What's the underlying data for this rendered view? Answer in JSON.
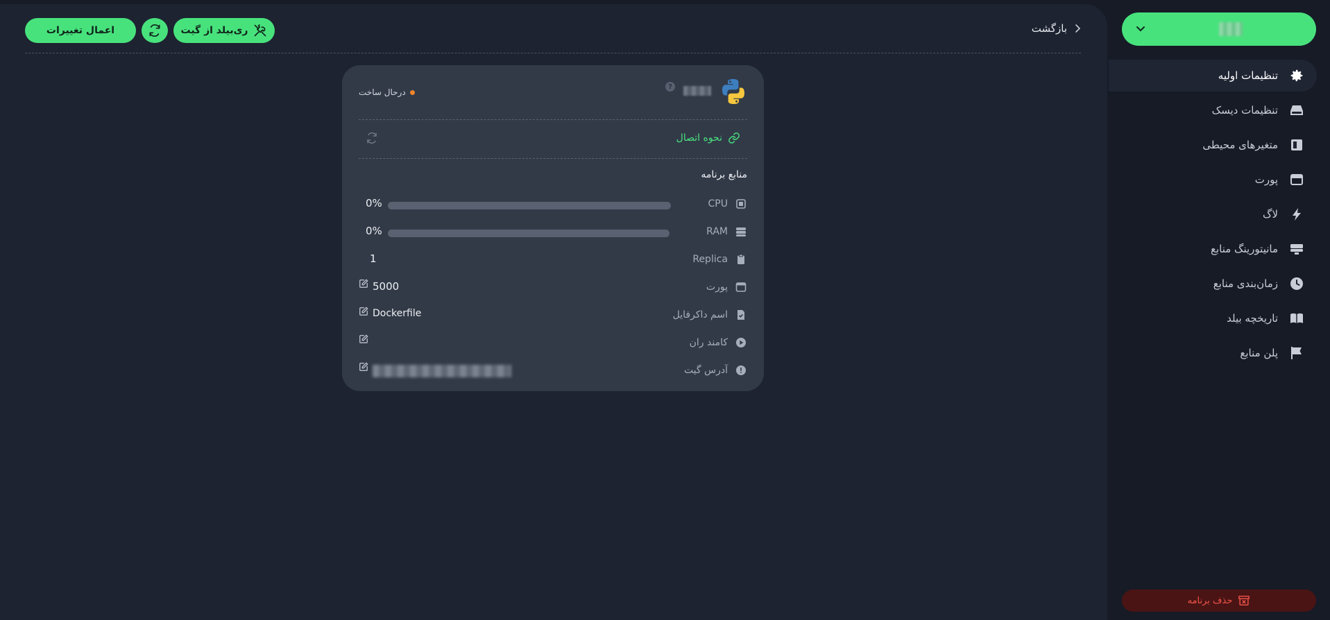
{
  "header": {
    "apply_label": "اعمال تغییرات",
    "rebuild_label": "ری‌بیلد از گیت",
    "back_label": "بازگشت"
  },
  "card": {
    "status": "درحال ساخت",
    "status_color": "#f2842b",
    "connect_label": "نحوه اتصال",
    "resources_title": "منابع برنامه",
    "rows": {
      "cpu": {
        "label": "CPU",
        "value": "0%",
        "fraction": 0
      },
      "ram": {
        "label": "RAM",
        "value": "0%",
        "fraction": 0
      },
      "replica": {
        "label": "Replica",
        "value": "1"
      },
      "port": {
        "label": "پورت",
        "value": "5000"
      },
      "dockerfile": {
        "label": "اسم داکرفایل",
        "value": "Dockerfile"
      },
      "run_command": {
        "label": "کامند ران",
        "value": ""
      },
      "git_url": {
        "label": "آدرس گیت"
      }
    }
  },
  "sidebar": {
    "items": [
      {
        "label": "تنظیمات اولیه",
        "icon": "gear-icon"
      },
      {
        "label": "تنظیمات دیسک",
        "icon": "disk-icon"
      },
      {
        "label": "متغیرهای محیطی",
        "icon": "env-icon"
      },
      {
        "label": "پورت",
        "icon": "port-icon"
      },
      {
        "label": "لاگ",
        "icon": "bolt-icon"
      },
      {
        "label": "مانیتورینگ منابع",
        "icon": "monitor-icon"
      },
      {
        "label": "زمان‌بندی منابع",
        "icon": "clock-icon"
      },
      {
        "label": "تاریخچه بیلد",
        "icon": "book-icon"
      },
      {
        "label": "پلن منابع",
        "icon": "flag-icon"
      }
    ],
    "delete_label": "حذف برنامه"
  },
  "colors": {
    "accent": "#48e27d",
    "danger": "#f2544a",
    "danger_bg": "#4a1414",
    "status_building": "#f2842b"
  }
}
